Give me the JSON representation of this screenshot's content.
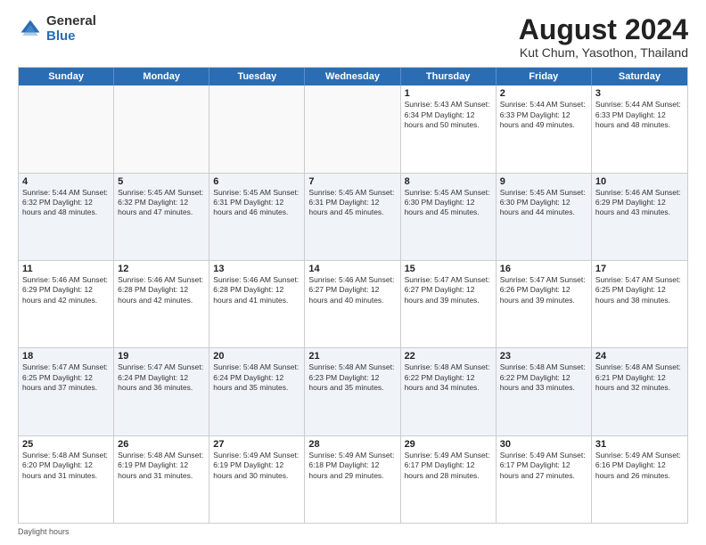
{
  "logo": {
    "general": "General",
    "blue": "Blue"
  },
  "title": "August 2024",
  "subtitle": "Kut Chum, Yasothon, Thailand",
  "days_of_week": [
    "Sunday",
    "Monday",
    "Tuesday",
    "Wednesday",
    "Thursday",
    "Friday",
    "Saturday"
  ],
  "weeks": [
    [
      {
        "day": "",
        "info": "",
        "empty": true
      },
      {
        "day": "",
        "info": "",
        "empty": true
      },
      {
        "day": "",
        "info": "",
        "empty": true
      },
      {
        "day": "",
        "info": "",
        "empty": true
      },
      {
        "day": "1",
        "info": "Sunrise: 5:43 AM\nSunset: 6:34 PM\nDaylight: 12 hours\nand 50 minutes."
      },
      {
        "day": "2",
        "info": "Sunrise: 5:44 AM\nSunset: 6:33 PM\nDaylight: 12 hours\nand 49 minutes."
      },
      {
        "day": "3",
        "info": "Sunrise: 5:44 AM\nSunset: 6:33 PM\nDaylight: 12 hours\nand 48 minutes."
      }
    ],
    [
      {
        "day": "4",
        "info": "Sunrise: 5:44 AM\nSunset: 6:32 PM\nDaylight: 12 hours\nand 48 minutes."
      },
      {
        "day": "5",
        "info": "Sunrise: 5:45 AM\nSunset: 6:32 PM\nDaylight: 12 hours\nand 47 minutes."
      },
      {
        "day": "6",
        "info": "Sunrise: 5:45 AM\nSunset: 6:31 PM\nDaylight: 12 hours\nand 46 minutes."
      },
      {
        "day": "7",
        "info": "Sunrise: 5:45 AM\nSunset: 6:31 PM\nDaylight: 12 hours\nand 45 minutes."
      },
      {
        "day": "8",
        "info": "Sunrise: 5:45 AM\nSunset: 6:30 PM\nDaylight: 12 hours\nand 45 minutes."
      },
      {
        "day": "9",
        "info": "Sunrise: 5:45 AM\nSunset: 6:30 PM\nDaylight: 12 hours\nand 44 minutes."
      },
      {
        "day": "10",
        "info": "Sunrise: 5:46 AM\nSunset: 6:29 PM\nDaylight: 12 hours\nand 43 minutes."
      }
    ],
    [
      {
        "day": "11",
        "info": "Sunrise: 5:46 AM\nSunset: 6:29 PM\nDaylight: 12 hours\nand 42 minutes."
      },
      {
        "day": "12",
        "info": "Sunrise: 5:46 AM\nSunset: 6:28 PM\nDaylight: 12 hours\nand 42 minutes."
      },
      {
        "day": "13",
        "info": "Sunrise: 5:46 AM\nSunset: 6:28 PM\nDaylight: 12 hours\nand 41 minutes."
      },
      {
        "day": "14",
        "info": "Sunrise: 5:46 AM\nSunset: 6:27 PM\nDaylight: 12 hours\nand 40 minutes."
      },
      {
        "day": "15",
        "info": "Sunrise: 5:47 AM\nSunset: 6:27 PM\nDaylight: 12 hours\nand 39 minutes."
      },
      {
        "day": "16",
        "info": "Sunrise: 5:47 AM\nSunset: 6:26 PM\nDaylight: 12 hours\nand 39 minutes."
      },
      {
        "day": "17",
        "info": "Sunrise: 5:47 AM\nSunset: 6:25 PM\nDaylight: 12 hours\nand 38 minutes."
      }
    ],
    [
      {
        "day": "18",
        "info": "Sunrise: 5:47 AM\nSunset: 6:25 PM\nDaylight: 12 hours\nand 37 minutes."
      },
      {
        "day": "19",
        "info": "Sunrise: 5:47 AM\nSunset: 6:24 PM\nDaylight: 12 hours\nand 36 minutes."
      },
      {
        "day": "20",
        "info": "Sunrise: 5:48 AM\nSunset: 6:24 PM\nDaylight: 12 hours\nand 35 minutes."
      },
      {
        "day": "21",
        "info": "Sunrise: 5:48 AM\nSunset: 6:23 PM\nDaylight: 12 hours\nand 35 minutes."
      },
      {
        "day": "22",
        "info": "Sunrise: 5:48 AM\nSunset: 6:22 PM\nDaylight: 12 hours\nand 34 minutes."
      },
      {
        "day": "23",
        "info": "Sunrise: 5:48 AM\nSunset: 6:22 PM\nDaylight: 12 hours\nand 33 minutes."
      },
      {
        "day": "24",
        "info": "Sunrise: 5:48 AM\nSunset: 6:21 PM\nDaylight: 12 hours\nand 32 minutes."
      }
    ],
    [
      {
        "day": "25",
        "info": "Sunrise: 5:48 AM\nSunset: 6:20 PM\nDaylight: 12 hours\nand 31 minutes."
      },
      {
        "day": "26",
        "info": "Sunrise: 5:48 AM\nSunset: 6:19 PM\nDaylight: 12 hours\nand 31 minutes."
      },
      {
        "day": "27",
        "info": "Sunrise: 5:49 AM\nSunset: 6:19 PM\nDaylight: 12 hours\nand 30 minutes."
      },
      {
        "day": "28",
        "info": "Sunrise: 5:49 AM\nSunset: 6:18 PM\nDaylight: 12 hours\nand 29 minutes."
      },
      {
        "day": "29",
        "info": "Sunrise: 5:49 AM\nSunset: 6:17 PM\nDaylight: 12 hours\nand 28 minutes."
      },
      {
        "day": "30",
        "info": "Sunrise: 5:49 AM\nSunset: 6:17 PM\nDaylight: 12 hours\nand 27 minutes."
      },
      {
        "day": "31",
        "info": "Sunrise: 5:49 AM\nSunset: 6:16 PM\nDaylight: 12 hours\nand 26 minutes."
      }
    ]
  ],
  "footer": "Daylight hours"
}
